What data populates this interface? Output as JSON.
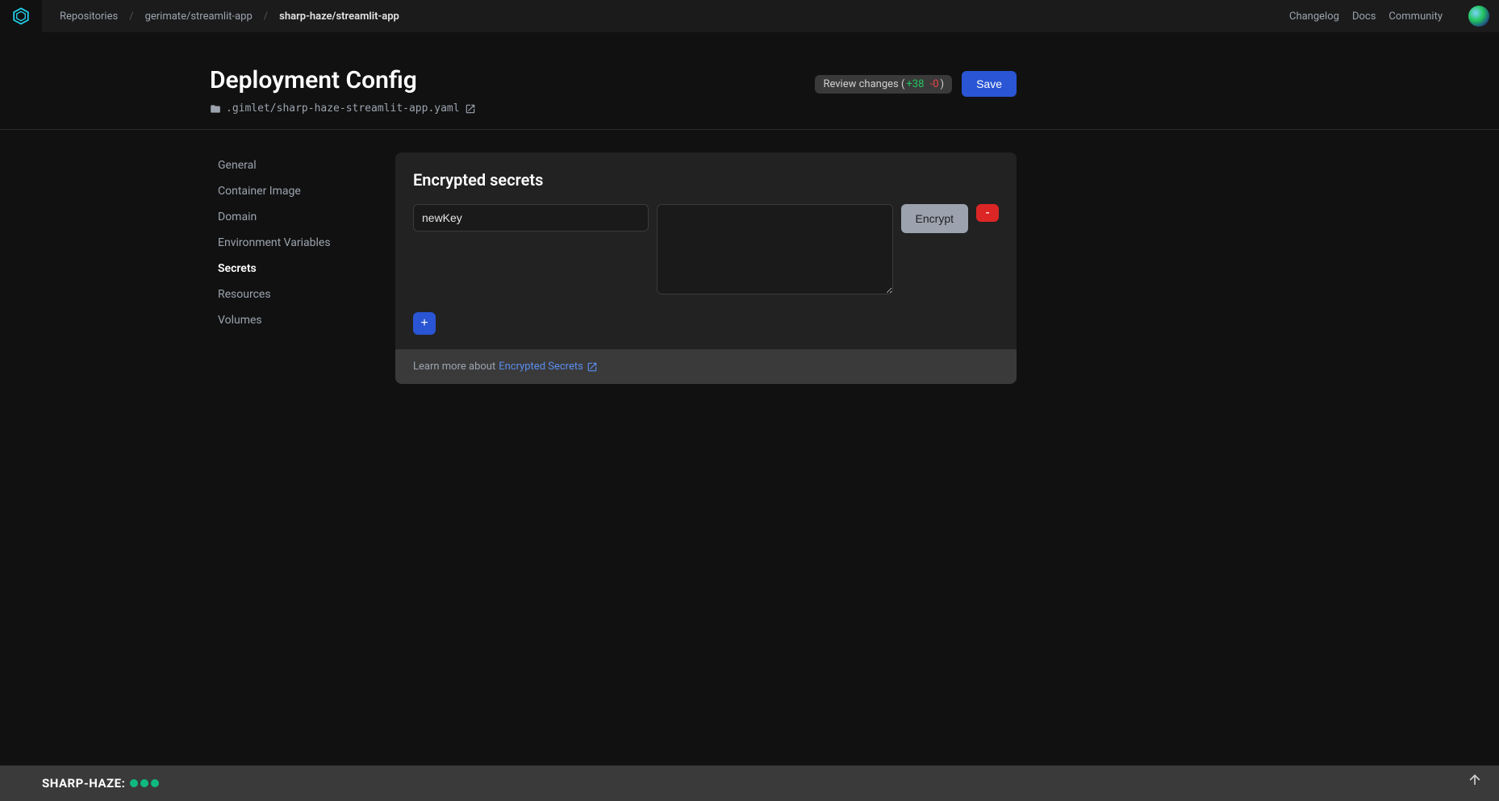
{
  "topbar": {
    "breadcrumbs": [
      {
        "label": "Repositories",
        "active": false
      },
      {
        "label": "gerimate/streamlit-app",
        "active": false
      },
      {
        "label": "sharp-haze/streamlit-app",
        "active": true
      }
    ],
    "links": {
      "changelog": "Changelog",
      "docs": "Docs",
      "community": "Community"
    }
  },
  "header": {
    "title": "Deployment Config",
    "file_path": ".gimlet/sharp-haze-streamlit-app.yaml",
    "review_label": "Review changes (",
    "review_plus": "+38",
    "review_minus": "-0",
    "review_close": ")",
    "save_label": "Save"
  },
  "sidebar": {
    "items": [
      {
        "label": "General",
        "active": false
      },
      {
        "label": "Container Image",
        "active": false
      },
      {
        "label": "Domain",
        "active": false
      },
      {
        "label": "Environment Variables",
        "active": false
      },
      {
        "label": "Secrets",
        "active": true
      },
      {
        "label": "Resources",
        "active": false
      },
      {
        "label": "Volumes",
        "active": false
      }
    ]
  },
  "secrets": {
    "card_title": "Encrypted secrets",
    "key_value": "newKey",
    "value_value": "",
    "encrypt_label": "Encrypt",
    "remove_label": "-",
    "add_label": "+",
    "footer_prefix": "Learn more about ",
    "footer_link": "Encrypted Secrets"
  },
  "statusbar": {
    "env": "SHARP-HAZE:"
  }
}
